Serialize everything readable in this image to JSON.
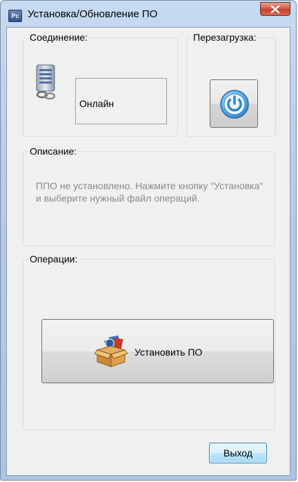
{
  "window": {
    "title": "Установка/Обновление ПО",
    "icon_text": "Pc"
  },
  "connection": {
    "label": "Соединение:",
    "status": "Онлайн",
    "icon": "server-link-icon"
  },
  "reboot": {
    "label": "Перезагрузка:",
    "icon": "power-icon"
  },
  "description": {
    "label": "Описание:",
    "text": "ППО не установлено. Нажмите кнопку \"Установка\" и выберите нужный файл операций."
  },
  "operations": {
    "label": "Операции:",
    "install_label": "Установить ПО",
    "icon": "software-box-icon"
  },
  "footer": {
    "exit_label": "Выход"
  },
  "colors": {
    "accent": "#4a9be0",
    "description_text": "#8a8a8a",
    "close_button": "#c4412a"
  }
}
